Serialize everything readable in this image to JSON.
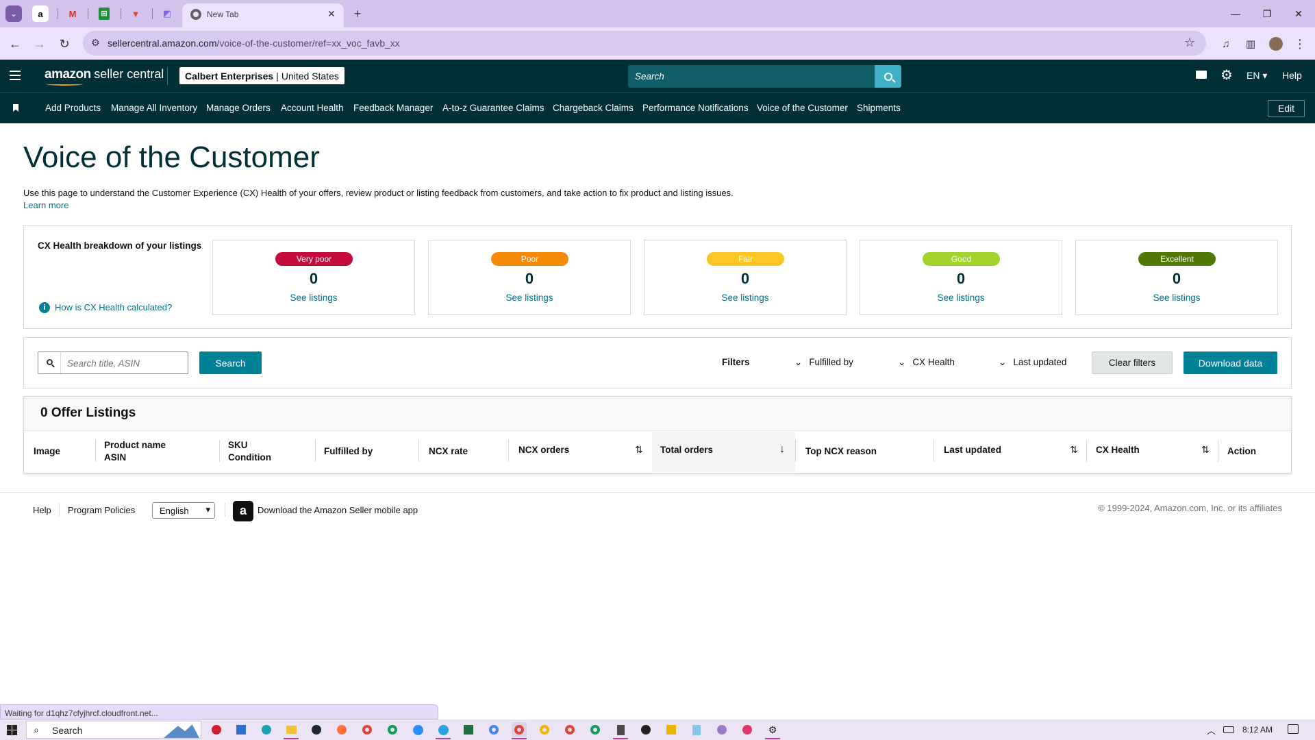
{
  "browser": {
    "tabs": [
      {
        "icon": "amazon-icon",
        "glyph": "a"
      },
      {
        "icon": "gmail-icon",
        "glyph": "M"
      },
      {
        "icon": "sheets-icon",
        "glyph": "⊞"
      },
      {
        "icon": "todoist-icon",
        "glyph": "▼"
      },
      {
        "icon": "clickup-icon",
        "glyph": "◩"
      }
    ],
    "active_tab_title": "New Tab",
    "url_host": "sellercentral.amazon.com",
    "url_path": "/voice-of-the-customer/ref=xx_voc_favb_xx"
  },
  "header": {
    "logo_text": "amazon",
    "logo_sub": "seller central",
    "account_name": "Calbert Enterprises",
    "account_region": "United States",
    "search_placeholder": "Search",
    "language": "EN",
    "help": "Help"
  },
  "nav": {
    "items": [
      "Add Products",
      "Manage All Inventory",
      "Manage Orders",
      "Account Health",
      "Feedback Manager",
      "A-to-z Guarantee Claims",
      "Chargeback Claims",
      "Performance Notifications",
      "Voice of the Customer",
      "Shipments"
    ],
    "edit": "Edit"
  },
  "page": {
    "title": "Voice of the Customer",
    "description": "Use this page to understand the Customer Experience (CX) Health of your offers, review product or listing feedback from customers, and take action to fix product and listing issues.",
    "learn_more": "Learn more"
  },
  "cx_health": {
    "heading": "CX Health breakdown of your listings",
    "how_link": "How is CX Health calculated?",
    "cards": [
      {
        "label": "Very poor",
        "count": "0",
        "link": "See listings",
        "color": "#c40c3c",
        "text_color": "#ffffff"
      },
      {
        "label": "Poor",
        "count": "0",
        "link": "See listings",
        "color": "#f58a07",
        "text_color": "#ffffff"
      },
      {
        "label": "Fair",
        "count": "0",
        "link": "See listings",
        "color": "#fcc624",
        "text_color": "#ffffff"
      },
      {
        "label": "Good",
        "count": "0",
        "link": "See listings",
        "color": "#a2d42d",
        "text_color": "#ffffff"
      },
      {
        "label": "Excellent",
        "count": "0",
        "link": "See listings",
        "color": "#507a05",
        "text_color": "#ffffff"
      }
    ]
  },
  "search": {
    "placeholder": "Search title, ASIN",
    "button": "Search"
  },
  "filters": {
    "label": "Filters",
    "fulfilled_by": "Fulfilled by",
    "cx_health": "CX Health",
    "last_updated": "Last updated",
    "clear": "Clear filters",
    "download": "Download data"
  },
  "table": {
    "title": "0 Offer Listings",
    "columns": {
      "image": "Image",
      "product_name": "Product name",
      "asin": "ASIN",
      "sku": "SKU",
      "condition": "Condition",
      "fulfilled_by": "Fulfilled by",
      "ncx_rate": "NCX rate",
      "ncx_orders": "NCX orders",
      "total_orders": "Total orders",
      "top_ncx_reason": "Top NCX reason",
      "last_updated": "Last updated",
      "cx_health": "CX Health",
      "action": "Action"
    }
  },
  "footer": {
    "help": "Help",
    "policies": "Program Policies",
    "language": "English",
    "app_link": "Download the Amazon Seller mobile app",
    "copyright": "© 1999-2024, Amazon.com, Inc. or its affiliates"
  },
  "status_text": "Waiting for d1qhz7cfyjhrcf.cloudfront.net...",
  "taskbar": {
    "search": "Search",
    "time": "8:12 AM"
  }
}
